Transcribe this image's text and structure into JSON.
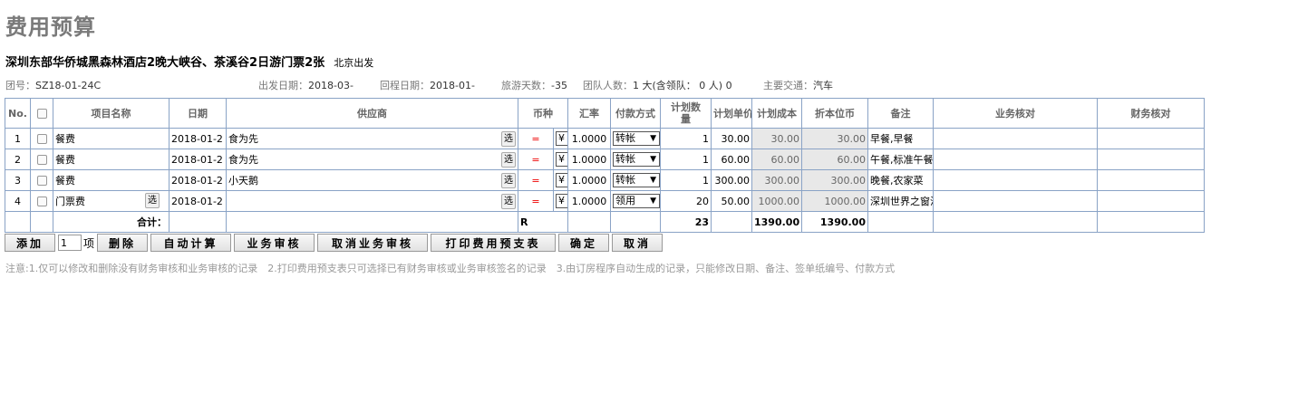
{
  "page": {
    "title": "费用预算"
  },
  "tour": {
    "name": "深圳东部华侨城黑森林酒店2晚大峡谷、茶溪谷2日游门票2张",
    "departure": "北京出发"
  },
  "info": {
    "group_label": "团号：",
    "group_no": "SZ18-01-24C",
    "depart_label": "出发日期：",
    "depart_date": "2018-03-",
    "return_label": "回程日期：",
    "return_date": "2018-01-",
    "days_label": "旅游天数：",
    "days": "-35",
    "people_label": "团队人数：",
    "people": "1 大(含领队： 0 人) 0",
    "transport_label": "主要交通：",
    "transport": "汽车"
  },
  "table": {
    "headers": {
      "no": "No.",
      "name": "项目名称",
      "date": "日期",
      "supplier": "供应商",
      "currency": "币种",
      "rate": "汇率",
      "payment": "付款方式",
      "qty": "计划数量",
      "unit_price": "计划单价",
      "cost": "计划成本",
      "base": "折本位币",
      "remark": "备注",
      "biz_check": "业务核对",
      "fin_check": "财务核对"
    },
    "select_label": "选",
    "eq": "=",
    "rows": [
      {
        "no": "1",
        "name": "餐费",
        "date": "2018-01-2",
        "supplier": "食为先",
        "currency": "¥",
        "rate": "1.0000",
        "payment": "转帐",
        "qty": "1",
        "unit_price": "30.00",
        "cost": "30.00",
        "base": "30.00",
        "remark": "早餐,早餐"
      },
      {
        "no": "2",
        "name": "餐费",
        "date": "2018-01-2",
        "supplier": "食为先",
        "currency": "¥",
        "rate": "1.0000",
        "payment": "转帐",
        "qty": "1",
        "unit_price": "60.00",
        "cost": "60.00",
        "base": "60.00",
        "remark": "午餐,标准午餐"
      },
      {
        "no": "3",
        "name": "餐费",
        "date": "2018-01-2",
        "supplier": "小天鹅",
        "currency": "¥",
        "rate": "1.0000",
        "payment": "转帐",
        "qty": "1",
        "unit_price": "300.00",
        "cost": "300.00",
        "base": "300.00",
        "remark": "晚餐,农家菜"
      },
      {
        "no": "4",
        "name": "门票费",
        "date": "2018-01-2",
        "supplier": "",
        "currency": "¥",
        "rate": "1.0000",
        "payment": "领用",
        "qty": "20",
        "unit_price": "50.00",
        "cost": "1000.00",
        "base": "1000.00",
        "remark": "深圳世界之窗滑冰+轮胎嬉雪+冰"
      }
    ],
    "total": {
      "label": "合计：",
      "currency": "R",
      "qty": "23",
      "cost": "1390.00",
      "base": "1390.00"
    }
  },
  "toolbar": {
    "add": "添加",
    "count": "1",
    "count_unit": "项",
    "delete": "删除",
    "auto_calc": "自动计算",
    "biz_audit": "业务审核",
    "cancel_biz_audit": "取消业务审核",
    "print_budget": "打印费用预支表",
    "confirm": "确定",
    "cancel": "取消"
  },
  "note": "注意:1.仅可以修改和删除没有财务审核和业务审核的记录　2.打印费用预支表只可选择已有财务审核或业务审核签名的记录　3.由订房程序自动生成的记录，只能修改日期、备注、签单纸编号、付款方式"
}
